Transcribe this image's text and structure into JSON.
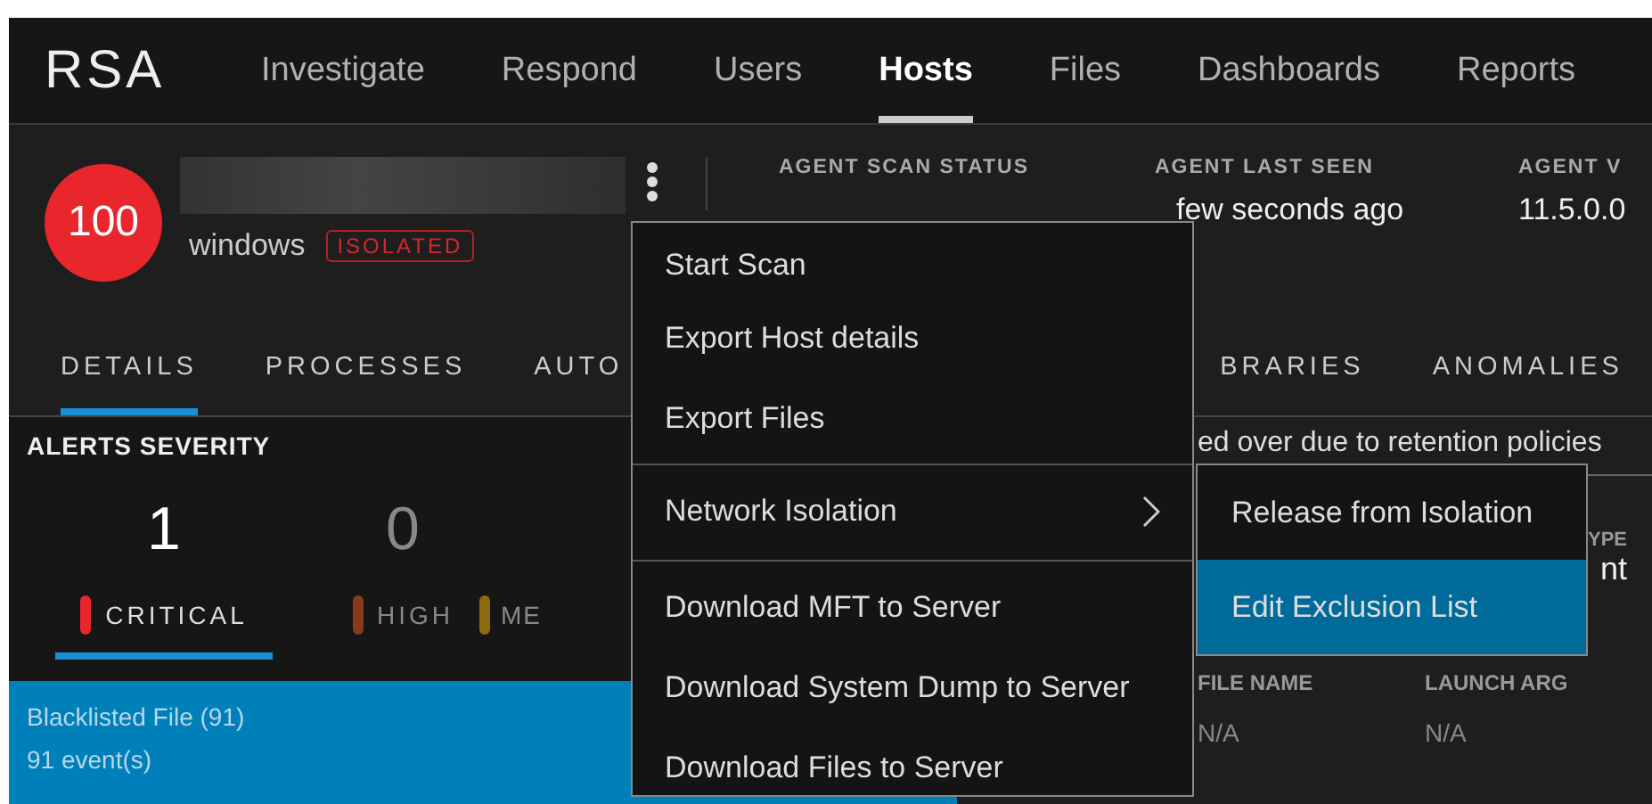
{
  "brand": "RSA",
  "nav": [
    {
      "label": "Investigate",
      "selected": false
    },
    {
      "label": "Respond",
      "selected": false
    },
    {
      "label": "Users",
      "selected": false
    },
    {
      "label": "Hosts",
      "selected": true
    },
    {
      "label": "Files",
      "selected": false
    },
    {
      "label": "Dashboards",
      "selected": false
    },
    {
      "label": "Reports",
      "selected": false
    }
  ],
  "host": {
    "risk_score": "100",
    "os": "windows",
    "status_badge": "ISOLATED"
  },
  "agent_info": [
    {
      "label": "AGENT SCAN STATUS"
    },
    {
      "label": "AGENT LAST SEEN",
      "value": "few seconds ago"
    },
    {
      "label": "AGENT V",
      "value": "11.5.0.0"
    }
  ],
  "tabs": [
    {
      "label": "DETAILS",
      "selected": true
    },
    {
      "label": "PROCESSES",
      "selected": false
    },
    {
      "label": "AUTO",
      "selected": false
    },
    {
      "label": "BRARIES",
      "selected": false
    },
    {
      "label": "ANOMALIES",
      "selected": false
    }
  ],
  "alerts_severity": {
    "title": "ALERTS SEVERITY",
    "levels": [
      {
        "count": "1",
        "label": "CRITICAL",
        "color": "#e8262b",
        "selected": true
      },
      {
        "count": "0",
        "label": "HIGH",
        "color": "#8a3a1c",
        "selected": false
      },
      {
        "label": "ME",
        "color": "#8c6a0e",
        "selected": false
      }
    ]
  },
  "alerts": [
    {
      "title": "Blacklisted File (91)",
      "events": "91 event(s)",
      "selected": true
    }
  ],
  "notice": "ed over due to retention policies",
  "detail_card": {
    "label": "YPE",
    "value": "nt"
  },
  "table": {
    "columns": [
      "FILE NAME",
      "LAUNCH ARG"
    ],
    "rows": [
      [
        "N/A",
        "N/A"
      ]
    ]
  },
  "context_menu": {
    "groups": [
      [
        {
          "label": "Start Scan",
          "has_submenu": false
        },
        {
          "label": "Export Host details",
          "has_submenu": false
        },
        {
          "label": "Export Files",
          "has_submenu": false
        }
      ],
      [
        {
          "label": "Network Isolation",
          "has_submenu": true
        }
      ],
      [
        {
          "label": "Download MFT to Server",
          "has_submenu": false
        },
        {
          "label": "Download System Dump to Server",
          "has_submenu": false
        },
        {
          "label": "Download Files to Server",
          "has_submenu": false
        }
      ]
    ],
    "submenu": [
      {
        "label": "Release from Isolation",
        "selected": false
      },
      {
        "label": "Edit Exclusion List",
        "selected": true
      }
    ]
  }
}
